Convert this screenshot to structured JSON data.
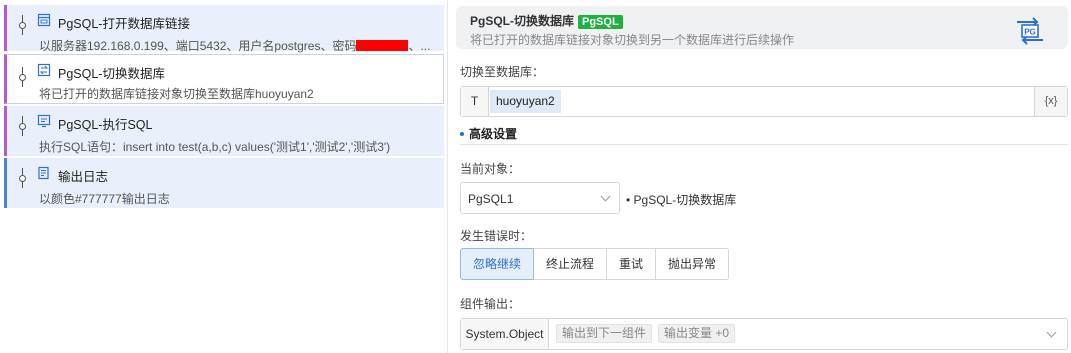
{
  "flow": {
    "steps": [
      {
        "title": "PgSQL-打开数据库链接",
        "desc_prefix": "以服务器192.168.0.199、端口5432、用户名postgres、密码",
        "desc_suffix": "、..."
      },
      {
        "title": "PgSQL-切换数据库",
        "desc": "将已打开的数据库链接对象切换至数据库huoyuyan2"
      },
      {
        "title": "PgSQL-执行SQL",
        "desc": "执行SQL语句：insert into test(a,b,c) values('测试1','测试2','测试3')"
      },
      {
        "title": "输出日志",
        "desc": "以颜色#777777输出日志"
      }
    ]
  },
  "panel": {
    "title": "PgSQL-切换数据库",
    "badge": "PgSQL",
    "description": "将已打开的数据库链接对象切换到另一个数据库进行后续操作",
    "switch_label": "切换至数据库：",
    "type_marker": "T",
    "database_value": "huoyuyan2",
    "expr_button": "{x}",
    "advanced_label": "高级设置",
    "current_object_label": "当前对象：",
    "current_object_value": "PgSQL1",
    "current_object_target": "• PgSQL-切换数据库",
    "on_error_label": "发生错误时：",
    "on_error_options": [
      "忽略继续",
      "终止流程",
      "重试",
      "抛出异常"
    ],
    "on_error_selected": 0,
    "output_label": "组件输出：",
    "output_type": "System.Object",
    "output_tags": [
      "输出到下一组件",
      "输出变量 +0"
    ]
  },
  "colors": {
    "accent": "#2f6fcb",
    "badge": "#1cb140",
    "step_border_purple": "#b35bd3",
    "step_border_blue": "#4a86d6",
    "redaction": "#ff0000"
  }
}
